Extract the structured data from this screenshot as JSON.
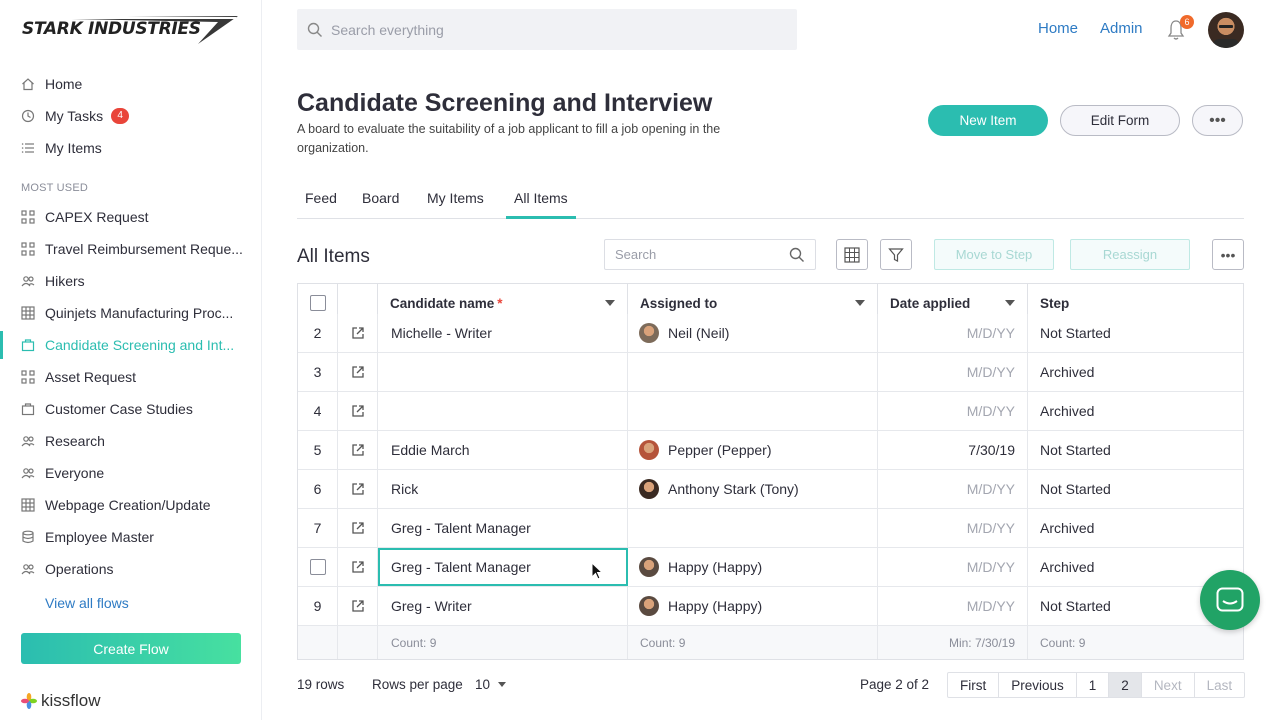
{
  "brand": {
    "name": "STARK INDUSTRIES",
    "footer": "kissflow"
  },
  "topbar": {
    "search_placeholder": "Search everything",
    "links": [
      "Home",
      "Admin"
    ],
    "notifications": "6"
  },
  "sidebar": {
    "main": [
      {
        "label": "Home",
        "icon": "home-icon"
      },
      {
        "label": "My Tasks",
        "icon": "clock-icon",
        "badge": "4"
      },
      {
        "label": "My Items",
        "icon": "list-icon"
      }
    ],
    "section_label": "MOST USED",
    "flows": [
      {
        "label": "CAPEX Request",
        "icon": "process-icon"
      },
      {
        "label": "Travel Reimbursement Reque...",
        "icon": "process-icon"
      },
      {
        "label": "Hikers",
        "icon": "people-icon"
      },
      {
        "label": "Quinjets Manufacturing Proc...",
        "icon": "grid-icon"
      },
      {
        "label": "Candidate Screening and Int...",
        "icon": "board-icon",
        "active": true
      },
      {
        "label": "Asset Request",
        "icon": "process-icon"
      },
      {
        "label": "Customer Case Studies",
        "icon": "board-icon"
      },
      {
        "label": "Research",
        "icon": "people-icon"
      },
      {
        "label": "Everyone",
        "icon": "people-icon"
      },
      {
        "label": "Webpage Creation/Update",
        "icon": "grid-icon"
      },
      {
        "label": "Employee Master",
        "icon": "database-icon"
      },
      {
        "label": "Operations",
        "icon": "people-icon"
      }
    ],
    "view_all": "View all flows",
    "create_flow": "Create Flow"
  },
  "page": {
    "title": "Candidate Screening and Interview",
    "description": "A board to evaluate the suitability of a job applicant to fill a job opening in the organization.",
    "new_item": "New Item",
    "edit_form": "Edit Form",
    "more": "•••"
  },
  "tabs": [
    "Feed",
    "Board",
    "My Items",
    "All Items"
  ],
  "active_tab": "All Items",
  "list": {
    "title": "All Items",
    "search_placeholder": "Search",
    "move_to_step": "Move to Step",
    "reassign": "Reassign",
    "more": "•••"
  },
  "table": {
    "columns": [
      {
        "label": "Candidate name",
        "required": "*"
      },
      {
        "label": "Assigned to"
      },
      {
        "label": "Date applied"
      },
      {
        "label": "Step"
      }
    ],
    "rows": [
      {
        "num": "2",
        "name": "Michelle - Writer",
        "assigned": "Neil (Neil)",
        "avatar_color": "#7d6b5a",
        "date": "M/D/YY",
        "date_placeholder": true,
        "step": "Not Started"
      },
      {
        "num": "3",
        "name": "",
        "assigned": "",
        "date": "M/D/YY",
        "date_placeholder": true,
        "step": "Archived"
      },
      {
        "num": "4",
        "name": "",
        "assigned": "",
        "date": "M/D/YY",
        "date_placeholder": true,
        "step": "Archived"
      },
      {
        "num": "5",
        "name": "Eddie March",
        "assigned": "Pepper (Pepper)",
        "avatar_color": "#b5543a",
        "date": "7/30/19",
        "date_placeholder": false,
        "step": "Not Started"
      },
      {
        "num": "6",
        "name": "Rick",
        "assigned": "Anthony Stark (Tony)",
        "avatar_color": "#3a2a22",
        "date": "M/D/YY",
        "date_placeholder": true,
        "step": "Not Started"
      },
      {
        "num": "7",
        "name": "Greg - Talent Manager",
        "assigned": "",
        "date": "M/D/YY",
        "date_placeholder": true,
        "step": "Archived"
      },
      {
        "num": "",
        "checkbox": true,
        "name": "Greg - Talent Manager",
        "selected": true,
        "assigned": "Happy (Happy)",
        "avatar_color": "#5a4a40",
        "date": "M/D/YY",
        "date_placeholder": true,
        "step": "Archived"
      },
      {
        "num": "9",
        "name": "Greg - Writer",
        "assigned": "Happy (Happy)",
        "avatar_color": "#5a4a40",
        "date": "M/D/YY",
        "date_placeholder": true,
        "step": "Not Started"
      }
    ],
    "footer": {
      "name": "Count: 9",
      "assigned": "Count: 9",
      "date": "Min: 7/30/19",
      "step": "Count: 9"
    }
  },
  "pagination": {
    "rows": "19 rows",
    "rows_per_page_label": "Rows per page",
    "rows_per_page": "10",
    "page_info": "Page 2 of 2",
    "buttons": [
      {
        "label": "First"
      },
      {
        "label": "Previous"
      },
      {
        "label": "1"
      },
      {
        "label": "2",
        "current": true
      },
      {
        "label": "Next",
        "disabled": true
      },
      {
        "label": "Last",
        "disabled": true
      }
    ]
  },
  "colors": {
    "accent": "#2bbdb0",
    "link": "#2e7bc4",
    "badge": "#e9453a",
    "chat": "#21a366"
  }
}
